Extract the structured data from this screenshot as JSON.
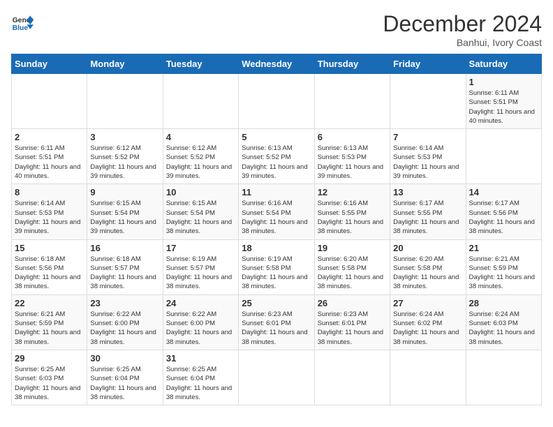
{
  "header": {
    "logo_line1": "General",
    "logo_line2": "Blue",
    "title": "December 2024",
    "subtitle": "Banhui, Ivory Coast"
  },
  "calendar": {
    "days_of_week": [
      "Sunday",
      "Monday",
      "Tuesday",
      "Wednesday",
      "Thursday",
      "Friday",
      "Saturday"
    ],
    "weeks": [
      [
        {
          "day": "",
          "info": ""
        },
        {
          "day": "",
          "info": ""
        },
        {
          "day": "",
          "info": ""
        },
        {
          "day": "",
          "info": ""
        },
        {
          "day": "",
          "info": ""
        },
        {
          "day": "",
          "info": ""
        },
        {
          "day": "1",
          "info": "Sunrise: 6:11 AM\nSunset: 5:51 PM\nDaylight: 11 hours\nand 40 minutes."
        }
      ],
      [
        {
          "day": "2",
          "info": "Sunrise: 6:11 AM\nSunset: 5:51 PM\nDaylight: 11 hours\nand 40 minutes."
        },
        {
          "day": "3",
          "info": "Sunrise: 6:12 AM\nSunset: 5:52 PM\nDaylight: 11 hours\nand 39 minutes."
        },
        {
          "day": "4",
          "info": "Sunrise: 6:12 AM\nSunset: 5:52 PM\nDaylight: 11 hours\nand 39 minutes."
        },
        {
          "day": "5",
          "info": "Sunrise: 6:13 AM\nSunset: 5:52 PM\nDaylight: 11 hours\nand 39 minutes."
        },
        {
          "day": "6",
          "info": "Sunrise: 6:13 AM\nSunset: 5:53 PM\nDaylight: 11 hours\nand 39 minutes."
        },
        {
          "day": "7",
          "info": "Sunrise: 6:14 AM\nSunset: 5:53 PM\nDaylight: 11 hours\nand 39 minutes."
        },
        {
          "day": "",
          "info": ""
        }
      ],
      [
        {
          "day": "8",
          "info": "Sunrise: 6:14 AM\nSunset: 5:53 PM\nDaylight: 11 hours\nand 39 minutes."
        },
        {
          "day": "9",
          "info": "Sunrise: 6:15 AM\nSunset: 5:54 PM\nDaylight: 11 hours\nand 39 minutes."
        },
        {
          "day": "10",
          "info": "Sunrise: 6:15 AM\nSunset: 5:54 PM\nDaylight: 11 hours\nand 38 minutes."
        },
        {
          "day": "11",
          "info": "Sunrise: 6:16 AM\nSunset: 5:54 PM\nDaylight: 11 hours\nand 38 minutes."
        },
        {
          "day": "12",
          "info": "Sunrise: 6:16 AM\nSunset: 5:55 PM\nDaylight: 11 hours\nand 38 minutes."
        },
        {
          "day": "13",
          "info": "Sunrise: 6:17 AM\nSunset: 5:55 PM\nDaylight: 11 hours\nand 38 minutes."
        },
        {
          "day": "14",
          "info": "Sunrise: 6:17 AM\nSunset: 5:56 PM\nDaylight: 11 hours\nand 38 minutes."
        }
      ],
      [
        {
          "day": "15",
          "info": "Sunrise: 6:18 AM\nSunset: 5:56 PM\nDaylight: 11 hours\nand 38 minutes."
        },
        {
          "day": "16",
          "info": "Sunrise: 6:18 AM\nSunset: 5:57 PM\nDaylight: 11 hours\nand 38 minutes."
        },
        {
          "day": "17",
          "info": "Sunrise: 6:19 AM\nSunset: 5:57 PM\nDaylight: 11 hours\nand 38 minutes."
        },
        {
          "day": "18",
          "info": "Sunrise: 6:19 AM\nSunset: 5:58 PM\nDaylight: 11 hours\nand 38 minutes."
        },
        {
          "day": "19",
          "info": "Sunrise: 6:20 AM\nSunset: 5:58 PM\nDaylight: 11 hours\nand 38 minutes."
        },
        {
          "day": "20",
          "info": "Sunrise: 6:20 AM\nSunset: 5:58 PM\nDaylight: 11 hours\nand 38 minutes."
        },
        {
          "day": "21",
          "info": "Sunrise: 6:21 AM\nSunset: 5:59 PM\nDaylight: 11 hours\nand 38 minutes."
        }
      ],
      [
        {
          "day": "22",
          "info": "Sunrise: 6:21 AM\nSunset: 5:59 PM\nDaylight: 11 hours\nand 38 minutes."
        },
        {
          "day": "23",
          "info": "Sunrise: 6:22 AM\nSunset: 6:00 PM\nDaylight: 11 hours\nand 38 minutes."
        },
        {
          "day": "24",
          "info": "Sunrise: 6:22 AM\nSunset: 6:00 PM\nDaylight: 11 hours\nand 38 minutes."
        },
        {
          "day": "25",
          "info": "Sunrise: 6:23 AM\nSunset: 6:01 PM\nDaylight: 11 hours\nand 38 minutes."
        },
        {
          "day": "26",
          "info": "Sunrise: 6:23 AM\nSunset: 6:01 PM\nDaylight: 11 hours\nand 38 minutes."
        },
        {
          "day": "27",
          "info": "Sunrise: 6:24 AM\nSunset: 6:02 PM\nDaylight: 11 hours\nand 38 minutes."
        },
        {
          "day": "28",
          "info": "Sunrise: 6:24 AM\nSunset: 6:03 PM\nDaylight: 11 hours\nand 38 minutes."
        }
      ],
      [
        {
          "day": "29",
          "info": "Sunrise: 6:25 AM\nSunset: 6:03 PM\nDaylight: 11 hours\nand 38 minutes."
        },
        {
          "day": "30",
          "info": "Sunrise: 6:25 AM\nSunset: 6:04 PM\nDaylight: 11 hours\nand 38 minutes."
        },
        {
          "day": "31",
          "info": "Sunrise: 6:25 AM\nSunset: 6:04 PM\nDaylight: 11 hours\nand 38 minutes."
        },
        {
          "day": "",
          "info": ""
        },
        {
          "day": "",
          "info": ""
        },
        {
          "day": "",
          "info": ""
        },
        {
          "day": "",
          "info": ""
        }
      ]
    ]
  }
}
